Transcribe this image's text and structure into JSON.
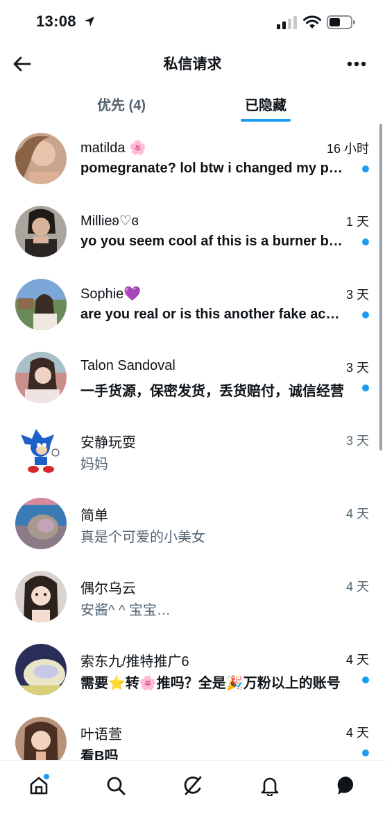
{
  "status_bar": {
    "time": "13:08"
  },
  "header": {
    "title": "私信请求"
  },
  "tabs": [
    {
      "label": "优先 (4)",
      "active": false
    },
    {
      "label": "已隐藏",
      "active": true
    }
  ],
  "conversations": [
    {
      "name": "matilda 🌸",
      "time": "16 小时",
      "message": "pomegranate? lol btw i changed my password",
      "unread": true
    },
    {
      "name": "Millieʚ♡ɞ",
      "time": "1 天",
      "message": "yo you seem cool af this is a burner but add me",
      "unread": true
    },
    {
      "name": "Sophie💜",
      "time": "3 天",
      "message": "are you real or is this another fake account",
      "unread": true
    },
    {
      "name": "Talon Sandoval",
      "time": "3 天",
      "message": "一手货源，保密发货，丢货赔付，诚信经营",
      "unread": true
    },
    {
      "name": "安静玩耍",
      "time": "3 天",
      "message": "妈妈",
      "unread": false
    },
    {
      "name": "简单",
      "time": "4 天",
      "message": "真是个可爱的小美女",
      "unread": false
    },
    {
      "name": "偶尔乌云",
      "time": "4 天",
      "message": "安酱^ ^ 宝宝…",
      "unread": false
    },
    {
      "name": "索东九/推特推广6",
      "time": "4 天",
      "message": "需要⭐转🌸推吗？全是🎉万粉以上的账号",
      "unread": true
    },
    {
      "name": "叶语萱",
      "time": "4 天",
      "message": "看B吗",
      "unread": true
    }
  ],
  "bottom_nav": [
    {
      "icon": "home-icon",
      "badge": true
    },
    {
      "icon": "search-icon",
      "badge": false
    },
    {
      "icon": "grok-icon",
      "badge": false
    },
    {
      "icon": "bell-icon",
      "badge": false
    },
    {
      "icon": "messages-icon",
      "badge": false
    }
  ],
  "colors": {
    "accent": "#1d9bf0",
    "text": "#0f1419",
    "secondary": "#536471"
  }
}
